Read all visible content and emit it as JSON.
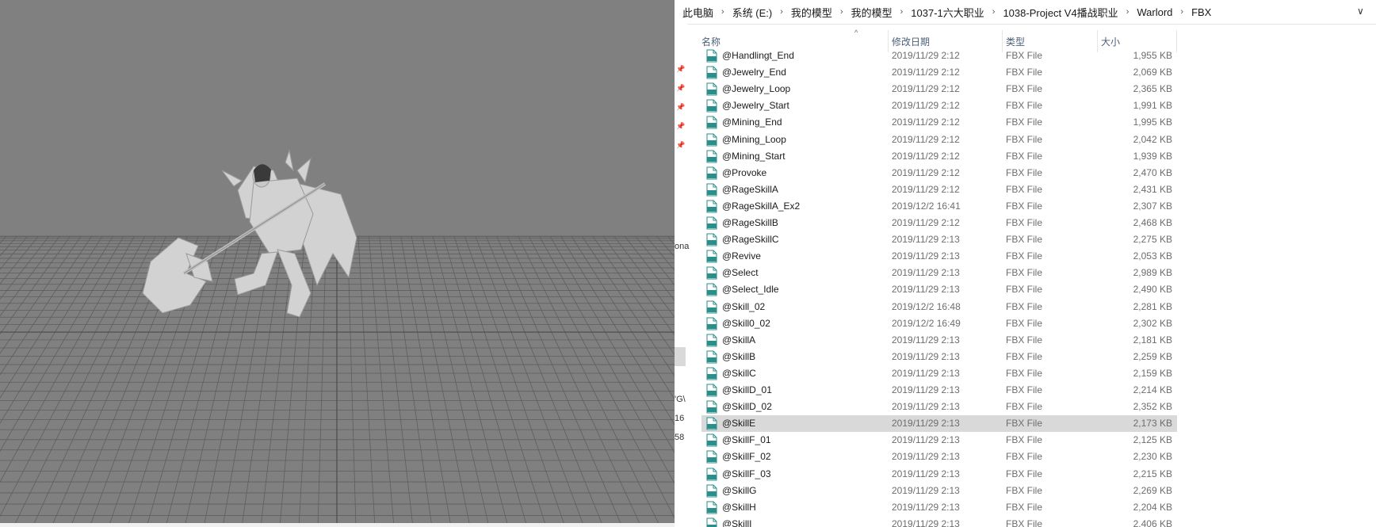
{
  "viewport": {
    "label": "3D viewport"
  },
  "explorer": {
    "breadcrumb": [
      "此电脑",
      "系统 (E:)",
      "我的模型",
      "我的模型",
      "1037-1六大职业",
      "1038-Project V4播战职业",
      "Warlord",
      "FBX"
    ],
    "breadcrumb_separator": "›",
    "dropdown_glyph": "∨",
    "columns": {
      "name": "名称",
      "date": "修改日期",
      "type": "类型",
      "size": "大小"
    },
    "sort_glyph": "^",
    "navpane_fragments": [
      "ona",
      "'G\\",
      "16",
      "58"
    ],
    "files": [
      {
        "name": "@Handlingt_End",
        "date": "2019/11/29 2:12",
        "type": "FBX File",
        "size": "1,955 KB"
      },
      {
        "name": "@Jewelry_End",
        "date": "2019/11/29 2:12",
        "type": "FBX File",
        "size": "2,069 KB"
      },
      {
        "name": "@Jewelry_Loop",
        "date": "2019/11/29 2:12",
        "type": "FBX File",
        "size": "2,365 KB"
      },
      {
        "name": "@Jewelry_Start",
        "date": "2019/11/29 2:12",
        "type": "FBX File",
        "size": "1,991 KB"
      },
      {
        "name": "@Mining_End",
        "date": "2019/11/29 2:12",
        "type": "FBX File",
        "size": "1,995 KB"
      },
      {
        "name": "@Mining_Loop",
        "date": "2019/11/29 2:12",
        "type": "FBX File",
        "size": "2,042 KB"
      },
      {
        "name": "@Mining_Start",
        "date": "2019/11/29 2:12",
        "type": "FBX File",
        "size": "1,939 KB"
      },
      {
        "name": "@Provoke",
        "date": "2019/11/29 2:12",
        "type": "FBX File",
        "size": "2,470 KB"
      },
      {
        "name": "@RageSkillA",
        "date": "2019/11/29 2:12",
        "type": "FBX File",
        "size": "2,431 KB"
      },
      {
        "name": "@RageSkillA_Ex2",
        "date": "2019/12/2 16:41",
        "type": "FBX File",
        "size": "2,307 KB"
      },
      {
        "name": "@RageSkillB",
        "date": "2019/11/29 2:12",
        "type": "FBX File",
        "size": "2,468 KB"
      },
      {
        "name": "@RageSkillC",
        "date": "2019/11/29 2:13",
        "type": "FBX File",
        "size": "2,275 KB"
      },
      {
        "name": "@Revive",
        "date": "2019/11/29 2:13",
        "type": "FBX File",
        "size": "2,053 KB"
      },
      {
        "name": "@Select",
        "date": "2019/11/29 2:13",
        "type": "FBX File",
        "size": "2,989 KB"
      },
      {
        "name": "@Select_Idle",
        "date": "2019/11/29 2:13",
        "type": "FBX File",
        "size": "2,490 KB"
      },
      {
        "name": "@Skill_02",
        "date": "2019/12/2 16:48",
        "type": "FBX File",
        "size": "2,281 KB"
      },
      {
        "name": "@Skill0_02",
        "date": "2019/12/2 16:49",
        "type": "FBX File",
        "size": "2,302 KB"
      },
      {
        "name": "@SkillA",
        "date": "2019/11/29 2:13",
        "type": "FBX File",
        "size": "2,181 KB"
      },
      {
        "name": "@SkillB",
        "date": "2019/11/29 2:13",
        "type": "FBX File",
        "size": "2,259 KB"
      },
      {
        "name": "@SkillC",
        "date": "2019/11/29 2:13",
        "type": "FBX File",
        "size": "2,159 KB"
      },
      {
        "name": "@SkillD_01",
        "date": "2019/11/29 2:13",
        "type": "FBX File",
        "size": "2,214 KB"
      },
      {
        "name": "@SkillD_02",
        "date": "2019/11/29 2:13",
        "type": "FBX File",
        "size": "2,352 KB"
      },
      {
        "name": "@SkillE",
        "date": "2019/11/29 2:13",
        "type": "FBX File",
        "size": "2,173 KB",
        "selected": true
      },
      {
        "name": "@SkillF_01",
        "date": "2019/11/29 2:13",
        "type": "FBX File",
        "size": "2,125 KB"
      },
      {
        "name": "@SkillF_02",
        "date": "2019/11/29 2:13",
        "type": "FBX File",
        "size": "2,230 KB"
      },
      {
        "name": "@SkillF_03",
        "date": "2019/11/29 2:13",
        "type": "FBX File",
        "size": "2,215 KB"
      },
      {
        "name": "@SkillG",
        "date": "2019/11/29 2:13",
        "type": "FBX File",
        "size": "2,269 KB"
      },
      {
        "name": "@SkillH",
        "date": "2019/11/29 2:13",
        "type": "FBX File",
        "size": "2,204 KB"
      },
      {
        "name": "@SkillI",
        "date": "2019/11/29 2:13",
        "type": "FBX File",
        "size": "2,406 KB"
      }
    ],
    "colors": {
      "icon_teal": "#2a8f8a",
      "selected_row": "#d9d9d9",
      "header_text": "#4c607a"
    }
  }
}
